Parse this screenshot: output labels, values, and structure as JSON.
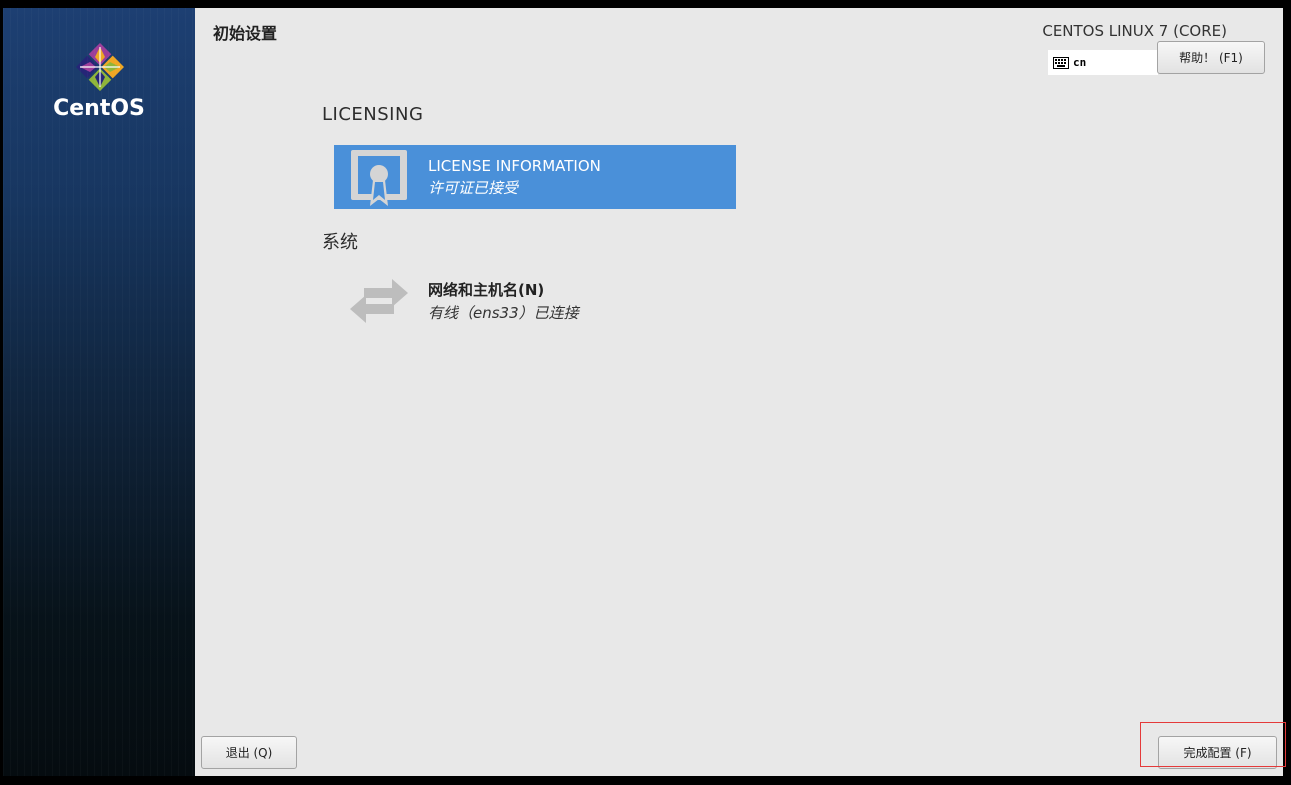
{
  "sidebar": {
    "brand": "CentOS"
  },
  "header": {
    "page_title": "初始设置",
    "product_name": "CENTOS LINUX 7 (CORE)",
    "keyboard_layout": "cn",
    "help_button": "帮助！ (F1)"
  },
  "sections": {
    "licensing": {
      "heading": "LICENSING",
      "spoke": {
        "title": "LICENSE INFORMATION",
        "status": "许可证已接受",
        "icon": "certificate-icon"
      }
    },
    "system": {
      "heading": "系统",
      "spoke": {
        "title": "网络和主机名(N)",
        "status": "有线（ens33）已连接",
        "icon": "network-arrows-icon"
      }
    }
  },
  "footer": {
    "quit_button": "退出 (Q)",
    "finish_button": "完成配置 (F)"
  },
  "colors": {
    "accent": "#4a90d9",
    "main_background": "#e8e8e8",
    "highlight_frame": "#e43a3a"
  }
}
